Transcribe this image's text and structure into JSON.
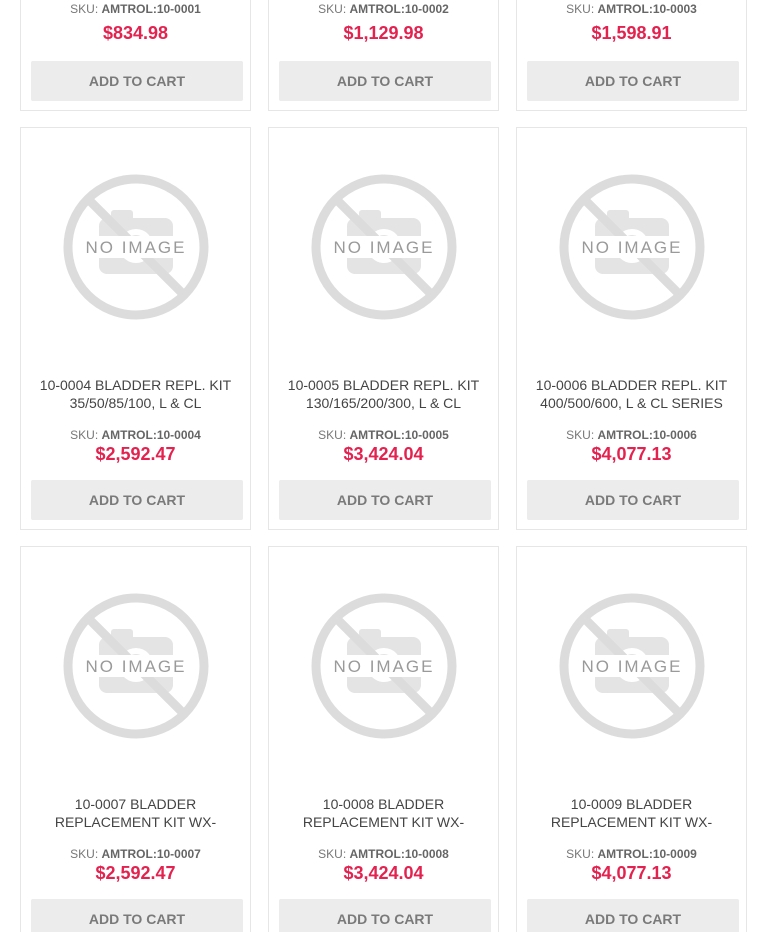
{
  "products": [
    {
      "title": "",
      "sku_label": "SKU:",
      "sku": "AMTROL:10-0001",
      "price": "$834.98",
      "cart_label": "ADD TO CART"
    },
    {
      "title": "",
      "sku_label": "SKU:",
      "sku": "AMTROL:10-0002",
      "price": "$1,129.98",
      "cart_label": "ADD TO CART"
    },
    {
      "title": "",
      "sku_label": "SKU:",
      "sku": "AMTROL:10-0003",
      "price": "$1,598.91",
      "cart_label": "ADD TO CART"
    },
    {
      "title": "10-0004 BLADDER REPL. KIT 35/50/85/100, L & CL",
      "sku_label": "SKU:",
      "sku": "AMTROL:10-0004",
      "price": "$2,592.47",
      "cart_label": "ADD TO CART",
      "image_text": "NO IMAGE"
    },
    {
      "title": "10-0005 BLADDER REPL. KIT 130/165/200/300, L & CL",
      "sku_label": "SKU:",
      "sku": "AMTROL:10-0005",
      "price": "$3,424.04",
      "cart_label": "ADD TO CART",
      "image_text": "NO IMAGE"
    },
    {
      "title": "10-0006 BLADDER REPL. KIT 400/500/600, L & CL SERIES",
      "sku_label": "SKU:",
      "sku": "AMTROL:10-0006",
      "price": "$4,077.13",
      "cart_label": "ADD TO CART",
      "image_text": "NO IMAGE"
    },
    {
      "title": "10-0007 BLADDER REPLACEMENT KIT WX-",
      "sku_label": "SKU:",
      "sku": "AMTROL:10-0007",
      "price": "$2,592.47",
      "cart_label": "ADD TO CART",
      "image_text": "NO IMAGE"
    },
    {
      "title": "10-0008 BLADDER REPLACEMENT KIT WX-",
      "sku_label": "SKU:",
      "sku": "AMTROL:10-0008",
      "price": "$3,424.04",
      "cart_label": "ADD TO CART",
      "image_text": "NO IMAGE"
    },
    {
      "title": "10-0009 BLADDER REPLACEMENT KIT WX-",
      "sku_label": "SKU:",
      "sku": "AMTROL:10-0009",
      "price": "$4,077.13",
      "cart_label": "ADD TO CART",
      "image_text": "NO IMAGE"
    }
  ],
  "colors": {
    "price": "#e3224f",
    "button_bg": "#ececec",
    "button_text": "#7a7a7a",
    "placeholder_gray": "#dcdcdc",
    "border": "#e6e6e6"
  },
  "icons": {
    "placeholder": "no-image-placeholder-icon"
  }
}
